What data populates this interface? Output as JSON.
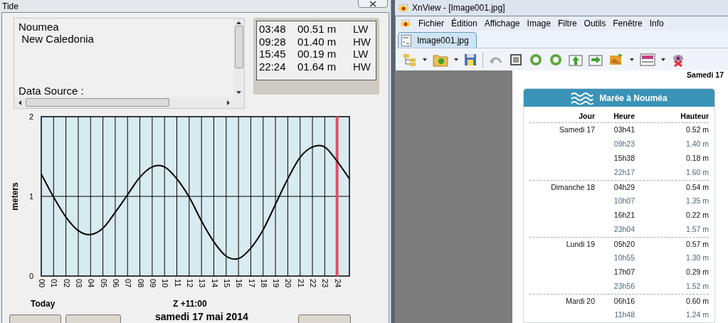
{
  "tide_window": {
    "title": "Tide",
    "location": {
      "lines": [
        "Noumea",
        " New Caledonia"
      ],
      "data_source": "Data Source :"
    },
    "tide_events": [
      {
        "time": "03:48",
        "height": "00.51 m",
        "type": "LW"
      },
      {
        "time": "09:28",
        "height": "01.40 m",
        "type": "HW"
      },
      {
        "time": "15:45",
        "height": "00.19 m",
        "type": "LW"
      },
      {
        "time": "22:24",
        "height": "01.64 m",
        "type": "HW"
      }
    ],
    "chart": {
      "chart_data": {
        "type": "line",
        "ylabel": "meters",
        "xlim": [
          0,
          25
        ],
        "ylim": [
          0,
          2
        ],
        "yticks": [
          0,
          1,
          2
        ],
        "xticks": [
          {
            "value": 0,
            "label": "00"
          },
          {
            "value": 1,
            "label": "01"
          },
          {
            "value": 2,
            "label": "02"
          },
          {
            "value": 3,
            "label": "03"
          },
          {
            "value": 4,
            "label": "04"
          },
          {
            "value": 5,
            "label": "05"
          },
          {
            "value": 6,
            "label": "06"
          },
          {
            "value": 7,
            "label": "07"
          },
          {
            "value": 8,
            "label": "08"
          },
          {
            "value": 9,
            "label": "09"
          },
          {
            "value": 10,
            "label": "10"
          },
          {
            "value": 11,
            "label": "11"
          },
          {
            "value": 12,
            "label": "12"
          },
          {
            "value": 13,
            "label": "13"
          },
          {
            "value": 14,
            "label": "14"
          },
          {
            "value": 15,
            "label": "15"
          },
          {
            "value": 16,
            "label": "16"
          },
          {
            "value": 17,
            "label": "17"
          },
          {
            "value": 18,
            "label": "18"
          },
          {
            "value": 19,
            "label": "19"
          },
          {
            "value": 20,
            "label": "20"
          },
          {
            "value": 21,
            "label": "21"
          },
          {
            "value": 22,
            "label": "22"
          },
          {
            "value": 23,
            "label": "23"
          },
          {
            "value": 24,
            "label": "24"
          }
        ],
        "x": [
          0,
          1,
          2,
          3,
          4,
          5,
          6,
          7,
          8,
          9,
          10,
          11,
          12,
          13,
          14,
          15,
          16,
          17,
          18,
          19,
          20,
          21,
          22,
          23,
          24,
          25
        ],
        "grid": true,
        "series": [
          {
            "color": "#000000",
            "values": [
              1.28,
              0.99,
              0.74,
              0.57,
              0.52,
              0.6,
              0.8,
              1.02,
              1.24,
              1.37,
              1.37,
              1.22,
              0.99,
              0.69,
              0.43,
              0.25,
              0.22,
              0.35,
              0.58,
              0.9,
              1.22,
              1.49,
              1.62,
              1.62,
              1.44,
              1.22
            ]
          }
        ],
        "ref_lines": [
          {
            "axis": "x",
            "value": 24,
            "color": "#e05068"
          }
        ]
      }
    },
    "footer": {
      "day_label": "Today",
      "zone": "Z +11:00",
      "date": "samedi 17 mai 2014"
    }
  },
  "xnview": {
    "title": "XnView - [Image001.jpg]",
    "menu": [
      "Fichier",
      "Édition",
      "Affichage",
      "Image",
      "Filtre",
      "Outils",
      "Fenêtre",
      "Info"
    ],
    "tabs": [
      {
        "label": "Image001.jpg",
        "selected": true
      }
    ],
    "image": {
      "caption": "Samedi 17",
      "card_title": "Marée à Nouméa",
      "columns": [
        "Jour",
        "Heure",
        "Hauteur"
      ],
      "rows": [
        {
          "day": "Samedi 17",
          "time": "03h41",
          "height": "0.52 m",
          "kind": "low"
        },
        {
          "time": "09h23",
          "height": "1.40 m",
          "kind": "high"
        },
        {
          "time": "15h38",
          "height": "0.18 m",
          "kind": "low"
        },
        {
          "time": "22h17",
          "height": "1.60 m",
          "kind": "high"
        },
        {
          "day": "Dimanche 18",
          "time": "04h29",
          "height": "0.54 m",
          "kind": "low"
        },
        {
          "time": "10h07",
          "height": "1.35 m",
          "kind": "high"
        },
        {
          "time": "16h21",
          "height": "0.22 m",
          "kind": "low"
        },
        {
          "time": "23h04",
          "height": "1.57 m",
          "kind": "high"
        },
        {
          "day": "Lundi 19",
          "time": "05h20",
          "height": "0.57 m",
          "kind": "low"
        },
        {
          "time": "10h55",
          "height": "1.30 m",
          "kind": "high"
        },
        {
          "time": "17h07",
          "height": "0.29 m",
          "kind": "low"
        },
        {
          "time": "23h56",
          "height": "1.52 m",
          "kind": "high"
        },
        {
          "day": "Mardi 20",
          "time": "06h16",
          "height": "0.60 m",
          "kind": "low"
        },
        {
          "time": "11h48",
          "height": "1.24 m",
          "kind": "high"
        }
      ]
    }
  }
}
